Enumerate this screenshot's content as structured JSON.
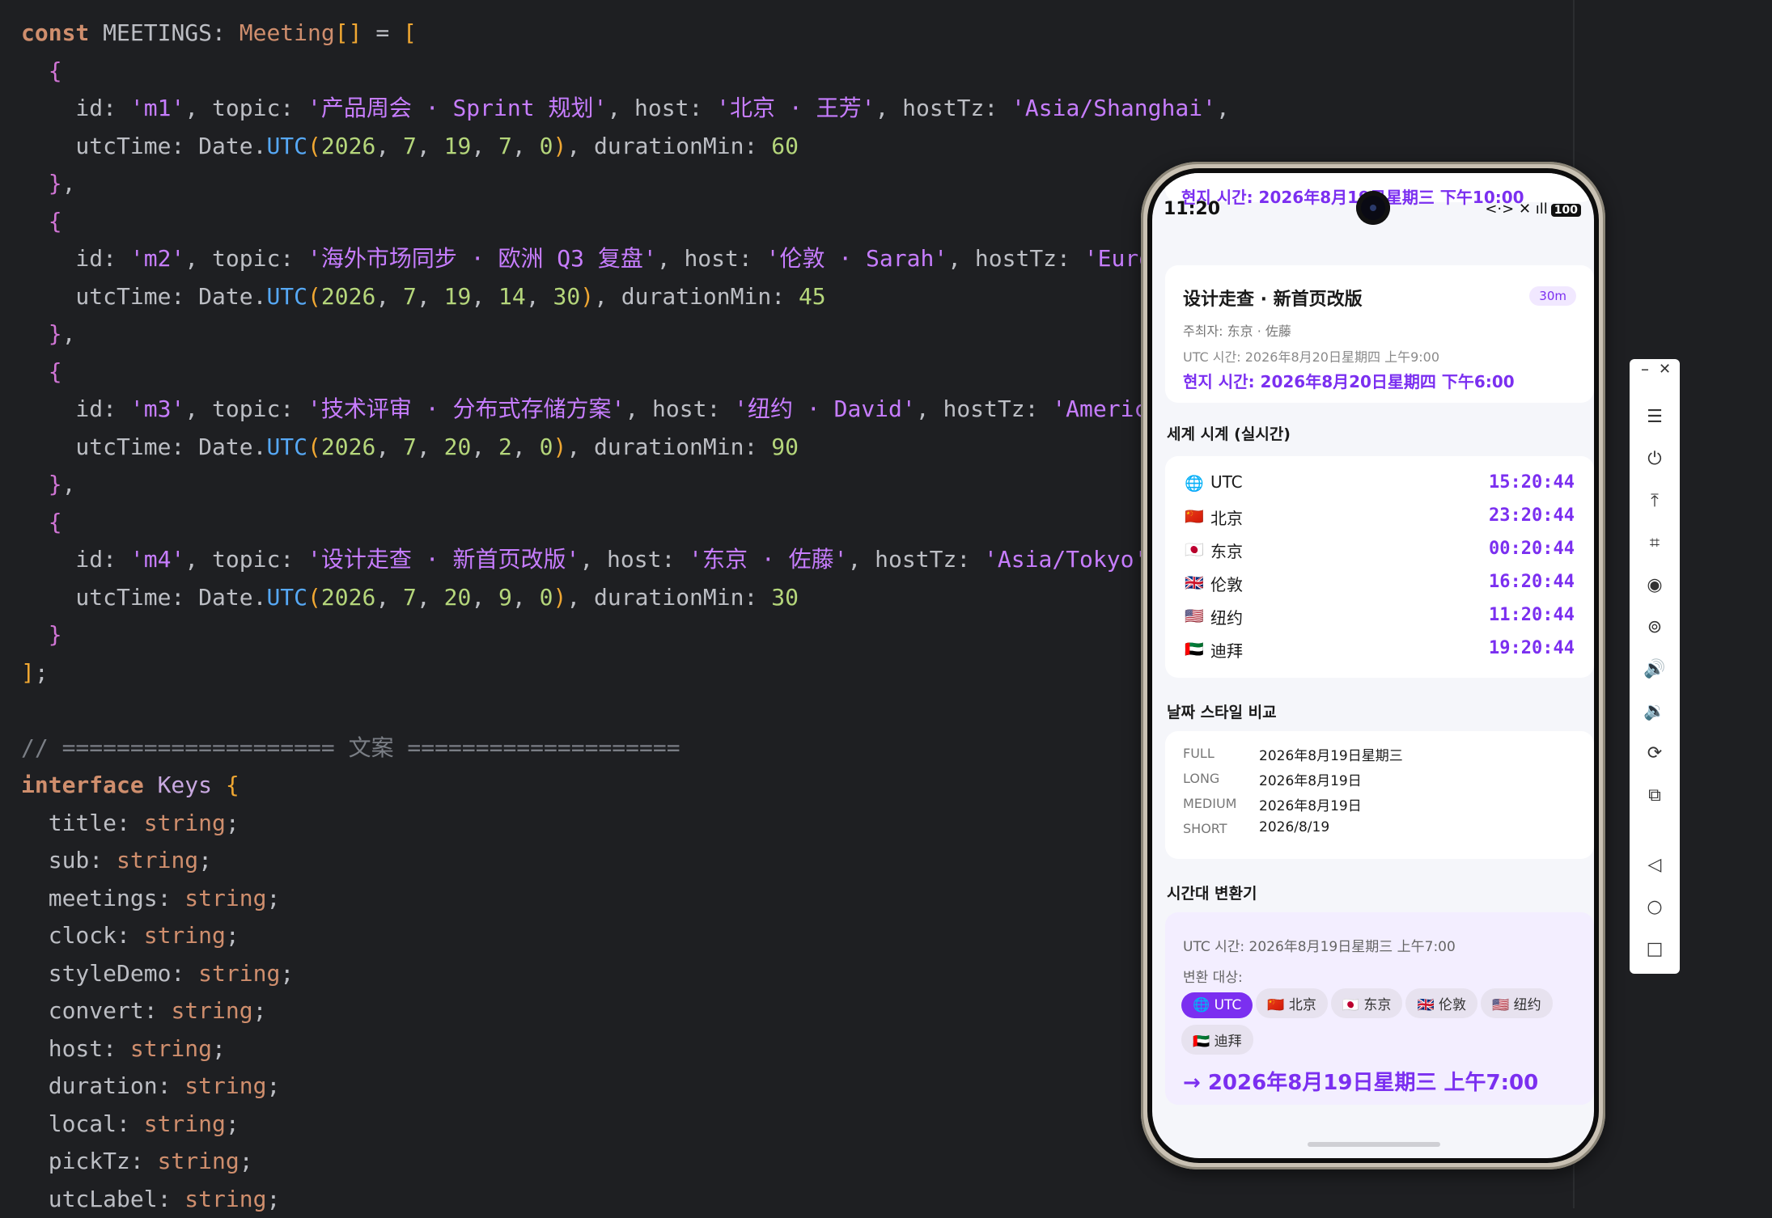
{
  "code_lines": [
    [
      [
        "kw",
        "const "
      ],
      [
        "gray",
        "MEETINGS: "
      ],
      [
        "ty",
        "Meeting"
      ],
      [
        "br1",
        "[]"
      ],
      [
        "gray",
        " = "
      ],
      [
        "br1",
        "["
      ]
    ],
    [
      [
        "gray",
        "  "
      ],
      [
        "br2",
        "{"
      ]
    ],
    [
      [
        "gray",
        "    id: "
      ],
      [
        "st",
        "'m1'"
      ],
      [
        "gray",
        ", topic: "
      ],
      [
        "st",
        "'产品周会 · Sprint 规划'"
      ],
      [
        "gray",
        ", host: "
      ],
      [
        "st",
        "'北京 · 王芳'"
      ],
      [
        "gray",
        ", hostTz: "
      ],
      [
        "st",
        "'Asia/Shanghai'"
      ],
      [
        "gray",
        ","
      ]
    ],
    [
      [
        "gray",
        "    utcTime: Date."
      ],
      [
        "fn",
        "UTC"
      ],
      [
        "br1",
        "("
      ],
      [
        "nm",
        "2026"
      ],
      [
        "gray",
        ", "
      ],
      [
        "nm",
        "7"
      ],
      [
        "gray",
        ", "
      ],
      [
        "nm",
        "19"
      ],
      [
        "gray",
        ", "
      ],
      [
        "nm",
        "7"
      ],
      [
        "gray",
        ", "
      ],
      [
        "nm",
        "0"
      ],
      [
        "br1",
        ")"
      ],
      [
        "gray",
        ", durationMin: "
      ],
      [
        "nm",
        "60"
      ]
    ],
    [
      [
        "gray",
        "  "
      ],
      [
        "br2",
        "}"
      ],
      [
        "gray",
        ","
      ]
    ],
    [
      [
        "gray",
        "  "
      ],
      [
        "br2",
        "{"
      ]
    ],
    [
      [
        "gray",
        "    id: "
      ],
      [
        "st",
        "'m2'"
      ],
      [
        "gray",
        ", topic: "
      ],
      [
        "st",
        "'海外市场同步 · 欧洲 Q3 复盘'"
      ],
      [
        "gray",
        ", host: "
      ],
      [
        "st",
        "'伦敦 · Sarah'"
      ],
      [
        "gray",
        ", hostTz: "
      ],
      [
        "st",
        "'Europe/"
      ]
    ],
    [
      [
        "gray",
        "    utcTime: Date."
      ],
      [
        "fn",
        "UTC"
      ],
      [
        "br1",
        "("
      ],
      [
        "nm",
        "2026"
      ],
      [
        "gray",
        ", "
      ],
      [
        "nm",
        "7"
      ],
      [
        "gray",
        ", "
      ],
      [
        "nm",
        "19"
      ],
      [
        "gray",
        ", "
      ],
      [
        "nm",
        "14"
      ],
      [
        "gray",
        ", "
      ],
      [
        "nm",
        "30"
      ],
      [
        "br1",
        ")"
      ],
      [
        "gray",
        ", durationMin: "
      ],
      [
        "nm",
        "45"
      ]
    ],
    [
      [
        "gray",
        "  "
      ],
      [
        "br2",
        "}"
      ],
      [
        "gray",
        ","
      ]
    ],
    [
      [
        "gray",
        "  "
      ],
      [
        "br2",
        "{"
      ]
    ],
    [
      [
        "gray",
        "    id: "
      ],
      [
        "st",
        "'m3'"
      ],
      [
        "gray",
        ", topic: "
      ],
      [
        "st",
        "'技术评审 · 分布式存储方案'"
      ],
      [
        "gray",
        ", host: "
      ],
      [
        "st",
        "'纽约 · David'"
      ],
      [
        "gray",
        ", hostTz: "
      ],
      [
        "st",
        "'America/Ne"
      ]
    ],
    [
      [
        "gray",
        "    utcTime: Date."
      ],
      [
        "fn",
        "UTC"
      ],
      [
        "br1",
        "("
      ],
      [
        "nm",
        "2026"
      ],
      [
        "gray",
        ", "
      ],
      [
        "nm",
        "7"
      ],
      [
        "gray",
        ", "
      ],
      [
        "nm",
        "20"
      ],
      [
        "gray",
        ", "
      ],
      [
        "nm",
        "2"
      ],
      [
        "gray",
        ", "
      ],
      [
        "nm",
        "0"
      ],
      [
        "br1",
        ")"
      ],
      [
        "gray",
        ", durationMin: "
      ],
      [
        "nm",
        "90"
      ]
    ],
    [
      [
        "gray",
        "  "
      ],
      [
        "br2",
        "}"
      ],
      [
        "gray",
        ","
      ]
    ],
    [
      [
        "gray",
        "  "
      ],
      [
        "br2",
        "{"
      ]
    ],
    [
      [
        "gray",
        "    id: "
      ],
      [
        "st",
        "'m4'"
      ],
      [
        "gray",
        ", topic: "
      ],
      [
        "st",
        "'设计走查 · 新首页改版'"
      ],
      [
        "gray",
        ", host: "
      ],
      [
        "st",
        "'东京 · 佐藤'"
      ],
      [
        "gray",
        ", hostTz: "
      ],
      [
        "st",
        "'Asia/Tokyo'"
      ],
      [
        "gray",
        ","
      ]
    ],
    [
      [
        "gray",
        "    utcTime: Date."
      ],
      [
        "fn",
        "UTC"
      ],
      [
        "br1",
        "("
      ],
      [
        "nm",
        "2026"
      ],
      [
        "gray",
        ", "
      ],
      [
        "nm",
        "7"
      ],
      [
        "gray",
        ", "
      ],
      [
        "nm",
        "20"
      ],
      [
        "gray",
        ", "
      ],
      [
        "nm",
        "9"
      ],
      [
        "gray",
        ", "
      ],
      [
        "nm",
        "0"
      ],
      [
        "br1",
        ")"
      ],
      [
        "gray",
        ", durationMin: "
      ],
      [
        "nm",
        "30"
      ]
    ],
    [
      [
        "gray",
        "  "
      ],
      [
        "br2",
        "}"
      ]
    ],
    [
      [
        "br1",
        "]"
      ],
      [
        "gray",
        ";"
      ]
    ],
    [
      [
        "gray",
        ""
      ]
    ],
    [
      [
        "cm",
        "// ==================== 文案 ===================="
      ]
    ],
    [
      [
        "kw",
        "interface "
      ],
      [
        "cls",
        "Keys "
      ],
      [
        "br1",
        "{"
      ]
    ],
    [
      [
        "gray",
        "  title: "
      ],
      [
        "ty",
        "string"
      ],
      [
        "gray",
        ";"
      ]
    ],
    [
      [
        "gray",
        "  sub: "
      ],
      [
        "ty",
        "string"
      ],
      [
        "gray",
        ";"
      ]
    ],
    [
      [
        "gray",
        "  meetings: "
      ],
      [
        "ty",
        "string"
      ],
      [
        "gray",
        ";"
      ]
    ],
    [
      [
        "gray",
        "  clock: "
      ],
      [
        "ty",
        "string"
      ],
      [
        "gray",
        ";"
      ]
    ],
    [
      [
        "gray",
        "  styleDemo: "
      ],
      [
        "ty",
        "string"
      ],
      [
        "gray",
        ";"
      ]
    ],
    [
      [
        "gray",
        "  convert: "
      ],
      [
        "ty",
        "string"
      ],
      [
        "gray",
        ";"
      ]
    ],
    [
      [
        "gray",
        "  host: "
      ],
      [
        "ty",
        "string"
      ],
      [
        "gray",
        ";"
      ]
    ],
    [
      [
        "gray",
        "  duration: "
      ],
      [
        "ty",
        "string"
      ],
      [
        "gray",
        ";"
      ]
    ],
    [
      [
        "gray",
        "  local: "
      ],
      [
        "ty",
        "string"
      ],
      [
        "gray",
        ";"
      ]
    ],
    [
      [
        "gray",
        "  pickTz: "
      ],
      [
        "ty",
        "string"
      ],
      [
        "gray",
        ";"
      ]
    ],
    [
      [
        "gray",
        "  utcLabel: "
      ],
      [
        "ty",
        "string"
      ],
      [
        "gray",
        ";"
      ]
    ]
  ],
  "phone": {
    "status_time": "11:20",
    "status_icons": "<·> ✕ ıll",
    "battery": "100",
    "prev_local": "현지 시간: 2026年8月19日星期三 下午10:00",
    "meeting": {
      "topic": "设计走查 · 新首页改版",
      "duration": "30m",
      "host": "주최자: 东京 · 佐藤",
      "utc": "UTC 시간: 2026年8月20日星期四 上午9:00",
      "local": "현지 시간: 2026年8月20日星期四 下午6:00"
    },
    "clock_title": "세계 시계 (실시간)",
    "clocks": [
      {
        "flag": "🌐",
        "city": "UTC",
        "time": "15:20:44"
      },
      {
        "flag": "🇨🇳",
        "city": "北京",
        "time": "23:20:44"
      },
      {
        "flag": "🇯🇵",
        "city": "东京",
        "time": "00:20:44"
      },
      {
        "flag": "🇬🇧",
        "city": "伦敦",
        "time": "16:20:44"
      },
      {
        "flag": "🇺🇸",
        "city": "纽约",
        "time": "11:20:44"
      },
      {
        "flag": "🇦🇪",
        "city": "迪拜",
        "time": "19:20:44"
      }
    ],
    "style_title": "날짜 스타일 비교",
    "styles": [
      {
        "k": "FULL",
        "v": "2026年8月19日星期三"
      },
      {
        "k": "LONG",
        "v": "2026年8月19日"
      },
      {
        "k": "MEDIUM",
        "v": "2026年8月19日"
      },
      {
        "k": "SHORT",
        "v": "2026/8/19"
      }
    ],
    "convert_title": "시간대 변환기",
    "convert": {
      "utc": "UTC 시간: 2026年8月19日星期三 上午7:00",
      "target_label": "변환 대상:",
      "chips": [
        "🌐 UTC",
        "🇨🇳 北京",
        "🇯🇵 东京",
        "🇬🇧 伦敦",
        "🇺🇸 纽约",
        "🇦🇪 迪拜"
      ],
      "active_index": 0,
      "result": "→ 2026年8月19日星期三 上午7:00"
    }
  },
  "toolbar": {
    "minimize": "–",
    "close": "✕",
    "buttons": [
      {
        "name": "menu-icon",
        "glyph": "☰"
      },
      {
        "name": "power-icon",
        "glyph": "⏻"
      },
      {
        "name": "rotate-top-icon",
        "glyph": "⤒"
      },
      {
        "name": "crop-icon",
        "glyph": "⌗"
      },
      {
        "name": "record-icon",
        "glyph": "◉"
      },
      {
        "name": "location-icon",
        "glyph": "⊚"
      },
      {
        "name": "volume-up-icon",
        "glyph": "🔊"
      },
      {
        "name": "volume-down-icon",
        "glyph": "🔉"
      },
      {
        "name": "rotate-icon",
        "glyph": "⟳"
      },
      {
        "name": "screenshot-icon",
        "glyph": "⧉"
      },
      {
        "name": "back-icon",
        "glyph": "◁"
      },
      {
        "name": "home-icon",
        "glyph": "○"
      },
      {
        "name": "overview-icon",
        "glyph": "□"
      }
    ]
  }
}
